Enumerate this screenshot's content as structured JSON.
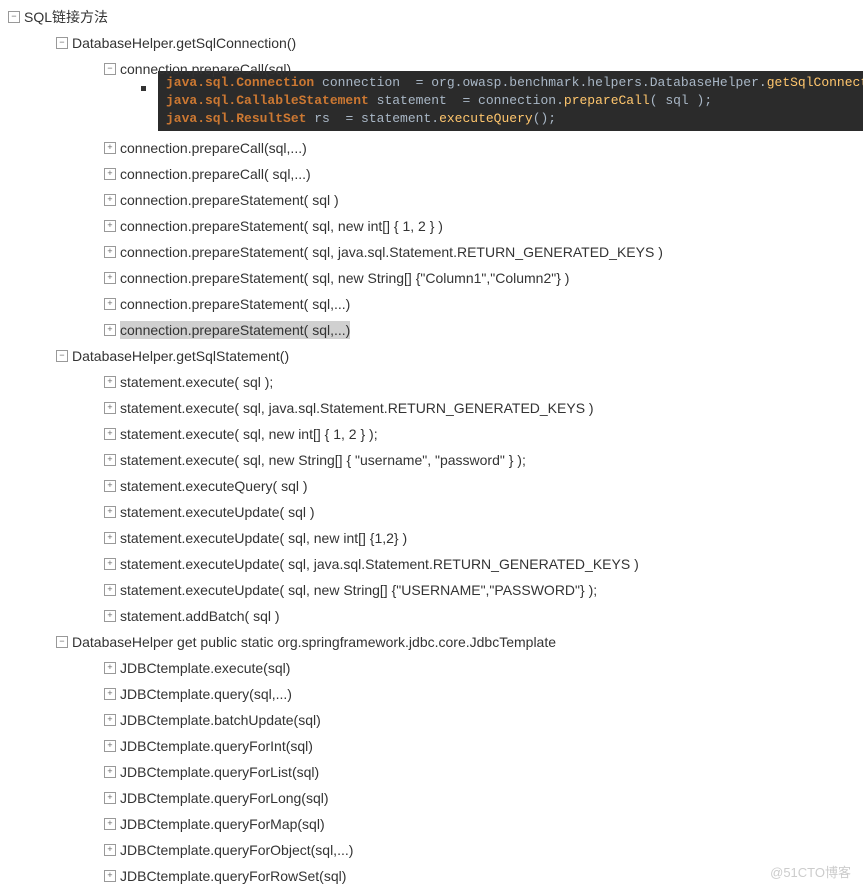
{
  "root": {
    "label": "SQL链接方法"
  },
  "section1": {
    "label": "DatabaseHelper.getSqlConnection()",
    "open_item": "connection.prepareCall(sql)",
    "code": {
      "l1_a": "java.sql.Connection",
      "l1_b": " connection  = org.owasp.benchmark.helpers.DatabaseHelper.",
      "l1_c": "getSqlConnection",
      "l1_d": "();",
      "l2_a": "java.sql.CallableStatement",
      "l2_b": " statement  = connection.",
      "l2_c": "prepareCall",
      "l2_d": "( sql );",
      "l3_a": "java.sql.ResultSet",
      "l3_b": " rs  = statement.",
      "l3_c": "executeQuery",
      "l3_d": "();"
    },
    "items": [
      "connection.prepareCall(sql,...)",
      "connection.prepareCall( sql,...)",
      "connection.prepareStatement( sql )",
      "connection.prepareStatement( sql, new int[] { 1, 2 } )",
      "connection.prepareStatement( sql,  java.sql.Statement.RETURN_GENERATED_KEYS )",
      "connection.prepareStatement( sql, new String[] {\"Column1\",\"Column2\"} )",
      "connection.prepareStatement( sql,...)",
      "connection.prepareStatement( sql,...)"
    ],
    "selected_index": 7
  },
  "section2": {
    "label": "DatabaseHelper.getSqlStatement()",
    "items": [
      "statement.execute( sql );",
      "statement.execute( sql, java.sql.Statement.RETURN_GENERATED_KEYS )",
      "statement.execute( sql, new int[] { 1, 2 } );",
      "statement.execute( sql, new String[] { \"username\", \"password\" } );",
      "statement.executeQuery( sql )",
      "statement.executeUpdate( sql )",
      "statement.executeUpdate( sql, new int[] {1,2} )",
      "statement.executeUpdate( sql, java.sql.Statement.RETURN_GENERATED_KEYS )",
      "statement.executeUpdate( sql, new String[] {\"USERNAME\",\"PASSWORD\"} );",
      "statement.addBatch( sql )"
    ]
  },
  "section3": {
    "label": "DatabaseHelper get public static org.springframework.jdbc.core.JdbcTemplate",
    "items": [
      "JDBCtemplate.execute(sql)",
      "JDBCtemplate.query(sql,...)",
      "JDBCtemplate.batchUpdate(sql)",
      "JDBCtemplate.queryForInt(sql)",
      "JDBCtemplate.queryForList(sql)",
      "JDBCtemplate.queryForLong(sql)",
      "JDBCtemplate.queryForMap(sql)",
      "JDBCtemplate.queryForObject(sql,...)",
      "JDBCtemplate.queryForRowSet(sql)"
    ]
  },
  "watermark": "@51CTO博客",
  "glyph": {
    "plus": "+",
    "minus": "−"
  }
}
